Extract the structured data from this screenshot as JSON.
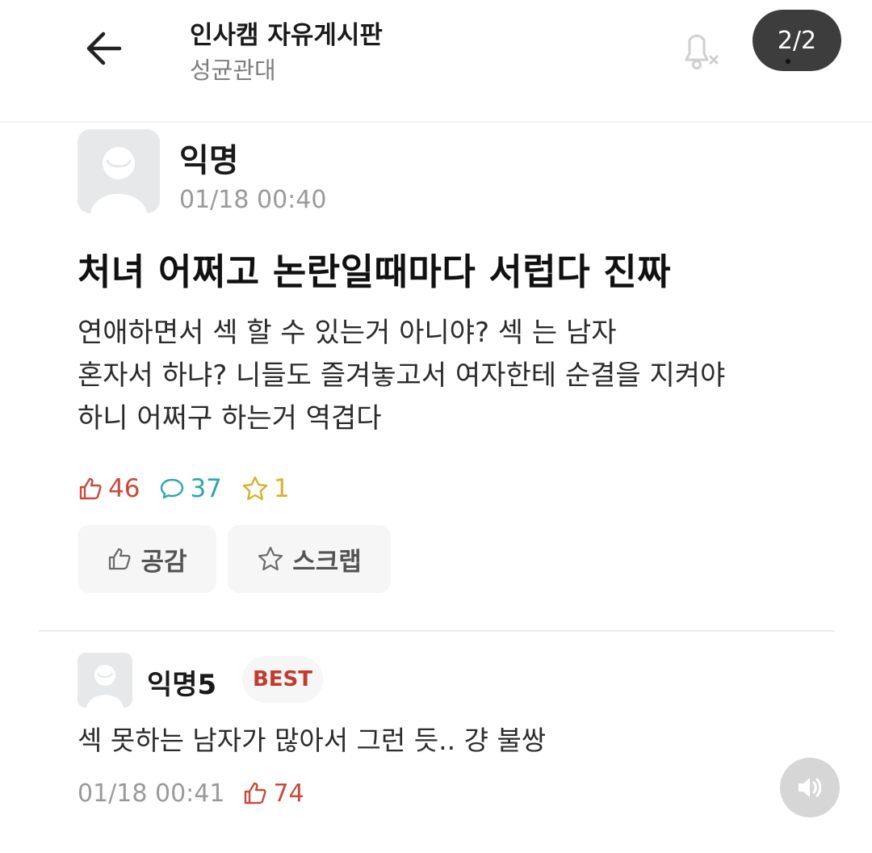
{
  "header": {
    "board_title": "인사캠 자유게시판",
    "board_subtitle": "성균관대",
    "page_indicator": "2/2"
  },
  "post": {
    "author": "익명",
    "timestamp": "01/18 00:40",
    "title": "처녀 어쩌고 논란일때마다 서럽다 진짜",
    "body_lines": [
      "연애하면서 섹    할 수 있는거 아니야? 섹   는 남자",
      "혼자서 하냐? 니들도 즐겨놓고서 여자한테 순결을 지켜야",
      "하니 어쩌구 하는거 역겹다"
    ],
    "stats": {
      "likes": "46",
      "comments": "37",
      "scraps": "1"
    },
    "actions": {
      "like_label": "공감",
      "scrap_label": "스크랩"
    }
  },
  "comment": {
    "author": "익명5",
    "badge": "BEST",
    "text": "섹    못하는 남자가 많아서 그런 듯.. 걍 불쌍",
    "timestamp": "01/18 00:41",
    "likes": "74"
  },
  "icons": {
    "back": "arrow-left-icon",
    "bell": "bell-off-icon",
    "like": "thumbs-up-icon",
    "comment": "speech-bubble-icon",
    "scrap": "star-icon",
    "sound": "speaker-icon"
  },
  "colors": {
    "like": "#c94a3c",
    "comment": "#2aa6b3",
    "scrap": "#d8b12c",
    "best_badge": "#c23b2c",
    "page_badge_bg": "#3d3d3d"
  }
}
